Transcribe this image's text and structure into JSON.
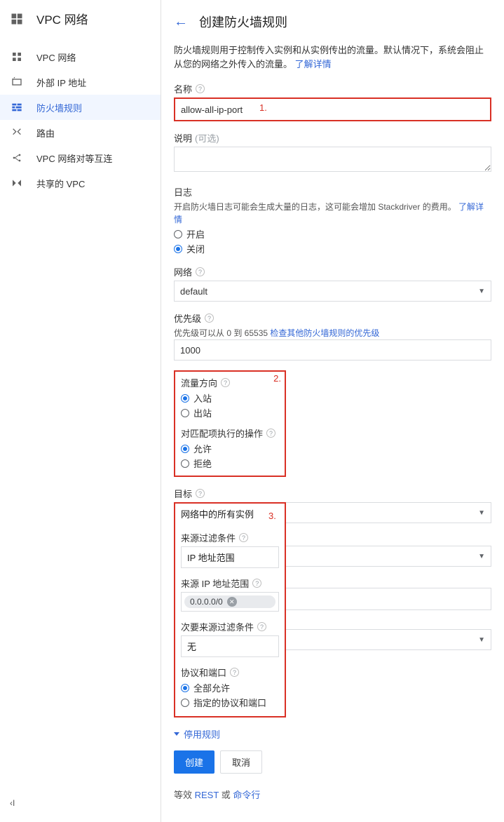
{
  "sidebar": {
    "title": "VPC 网络",
    "items": [
      {
        "label": "VPC 网络"
      },
      {
        "label": "外部 IP 地址"
      },
      {
        "label": "防火墙规则"
      },
      {
        "label": "路由"
      },
      {
        "label": "VPC 网络对等互连"
      },
      {
        "label": "共享的 VPC"
      }
    ],
    "collapse": "‹І"
  },
  "header": {
    "back": "←",
    "title": "创建防火墙规则"
  },
  "description": {
    "text": "防火墙规则用于控制传入实例和从实例传出的流量。默认情况下，系统会阻止从您的网络之外传入的流量。",
    "link": "了解详情"
  },
  "name": {
    "label": "名称",
    "value": "allow-all-ip-port"
  },
  "explain": {
    "label": "说明",
    "opt": "(可选)"
  },
  "logs": {
    "label": "日志",
    "sub": "开启防火墙日志可能会生成大量的日志，这可能会增加 Stackdriver 的费用。",
    "link": "了解详情",
    "on": "开启",
    "off": "关闭"
  },
  "network": {
    "label": "网络",
    "value": "default"
  },
  "priority": {
    "label": "优先级",
    "hint": "优先级可以从 0 到 65535 ",
    "link": "检查其他防火墙规则的优先级",
    "value": "1000"
  },
  "direction": {
    "label": "流量方向",
    "in": "入站",
    "out": "出站"
  },
  "action": {
    "label": "对匹配项执行的操作",
    "allow": "允许",
    "deny": "拒绝"
  },
  "target": {
    "label": "目标",
    "value": "网络中的所有实例"
  },
  "source_filter": {
    "label": "来源过滤条件",
    "value": "IP 地址范围"
  },
  "source_ip": {
    "label": "来源 IP 地址范围",
    "chip": "0.0.0.0/0"
  },
  "secondary_filter": {
    "label": "次要来源过滤条件",
    "value": "无"
  },
  "protocols": {
    "label": "协议和端口",
    "all": "全部允许",
    "specified": "指定的协议和端口"
  },
  "expand_link": "停用规则",
  "buttons": {
    "create": "创建",
    "cancel": "取消"
  },
  "footer": {
    "pre": "等效 ",
    "rest": "REST",
    "or": " 或 ",
    "cli": "命令行"
  },
  "annotations": {
    "one": "1.",
    "two": "2.",
    "three": "3."
  }
}
